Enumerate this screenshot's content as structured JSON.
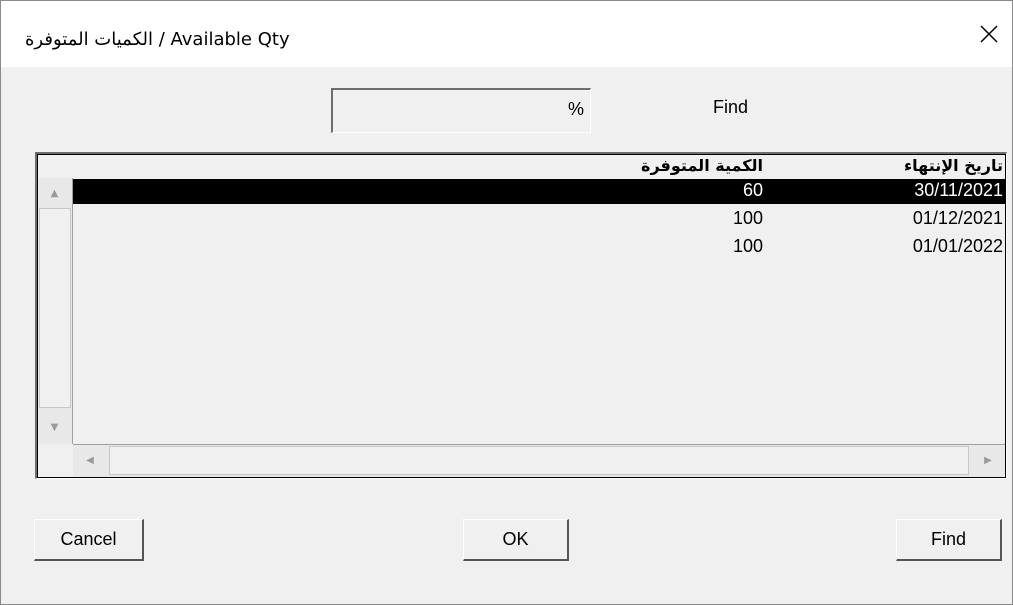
{
  "window": {
    "title": "الكميات المتوفرة / Available Qty",
    "close_symbol": "✕"
  },
  "search": {
    "label": "Find",
    "value": "%"
  },
  "grid": {
    "columns": {
      "quantity": "الكمية المتوفرة",
      "expiry_date": "تاريخ الإنتهاء"
    },
    "rows": [
      {
        "quantity": "60",
        "expiry_date": "30/11/2021",
        "selected": true
      },
      {
        "quantity": "100",
        "expiry_date": "01/12/2021",
        "selected": false
      },
      {
        "quantity": "100",
        "expiry_date": "01/01/2022",
        "selected": false
      }
    ],
    "scroll_up_symbol": "▲",
    "scroll_down_symbol": "▼",
    "scroll_left_symbol": "◀",
    "scroll_right_symbol": "▶"
  },
  "buttons": {
    "cancel": "Cancel",
    "ok": "OK",
    "find": "Find"
  }
}
